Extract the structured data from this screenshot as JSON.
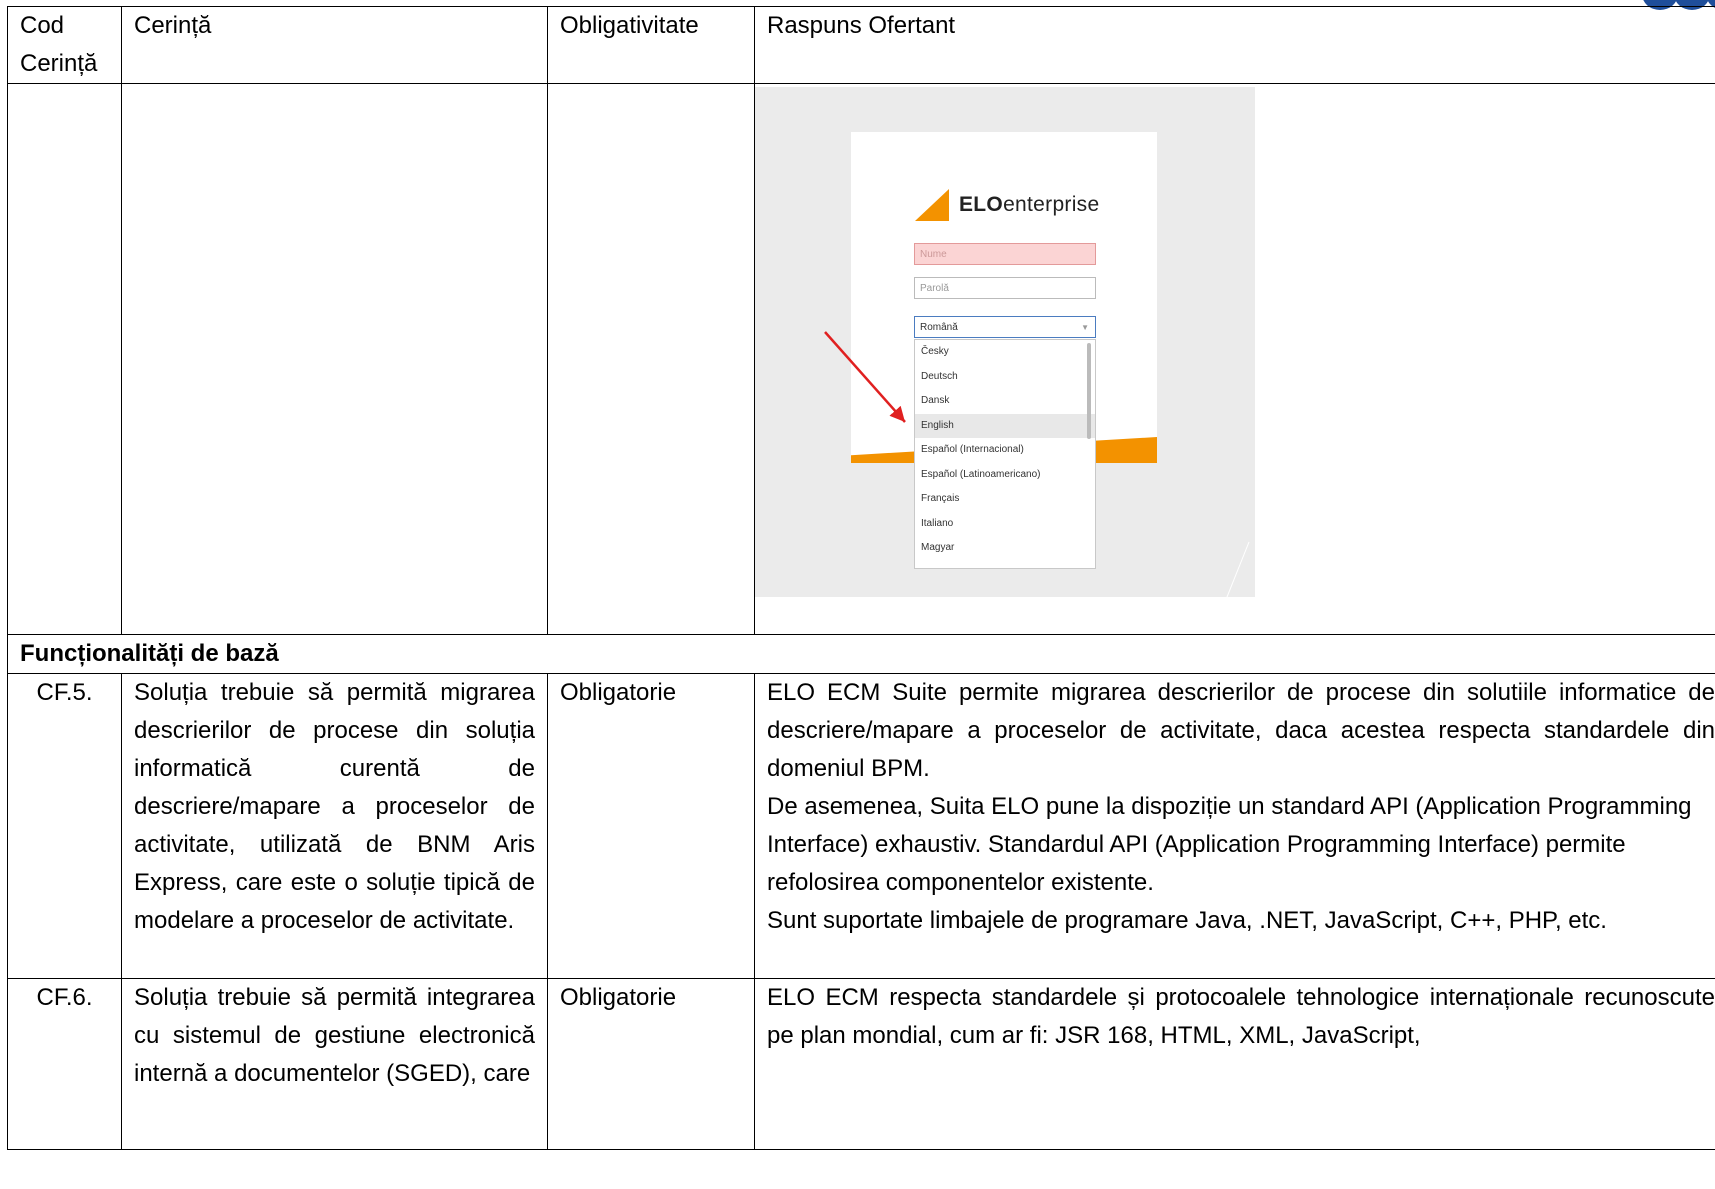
{
  "header": {
    "col_code": "Cod Cerință",
    "col_requirement": "Cerință",
    "col_mandatory": "Obligativitate",
    "col_response": "Raspuns Ofertant"
  },
  "login_screenshot": {
    "logo_bold": "ELO",
    "logo_rest": "enterprise",
    "name_placeholder": "Nume",
    "password_placeholder": "Parolă",
    "language_selected": "Română",
    "language_options": [
      "Česky",
      "Deutsch",
      "Dansk",
      "English",
      "Español (Internacional)",
      "Español (Latinoamericano)",
      "Français",
      "Italiano",
      "Magyar"
    ],
    "highlighted_option": "English",
    "accent_color": "#f39200",
    "arrow_color": "#e02020"
  },
  "section_title": "Funcționalități de bază",
  "rows": [
    {
      "code": "CF.5.",
      "requirement": "Soluția trebuie să permită migrarea descrierilor de procese din soluția informatică curentă de descriere/mapare a proceselor de activitate, utilizată de BNM Aris Express, care este o soluție tipică de modelare a proceselor de activitate.",
      "mandatory": "Obligatorie",
      "response_p1": "ELO ECM Suite permite migrarea descrierilor de procese din solutiile informatice de descriere/mapare a proceselor de activitate, daca acestea respecta standardele din domeniul BPM.",
      "response_p2": "De asemenea, Suita ELO pune la dispoziție un standard API (Application Programming Interface) exhaustiv. Standardul API (Application Programming Interface) permite refolosirea componentelor existente.",
      "response_p3": "Sunt suportate limbajele de programare Java, .NET, JavaScript, C++, PHP, etc."
    },
    {
      "code": "CF.6.",
      "requirement": "Soluția trebuie să permită integrarea cu sistemul de gestiune electronică internă a documentelor (SGED), care",
      "mandatory": "Obligatorie",
      "response_p1": "ELO ECM respecta standardele și protocoalele tehnologice internaționale recunoscute pe plan mondial, cum ar fi: JSR 168, HTML, XML, JavaScript,"
    }
  ]
}
